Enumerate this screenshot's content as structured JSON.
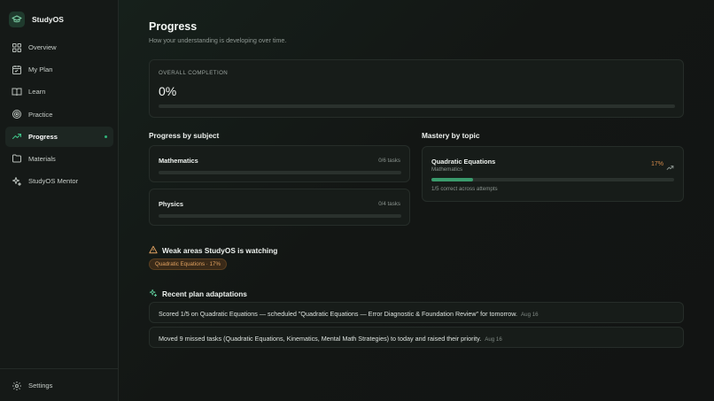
{
  "app": {
    "name": "StudyOS"
  },
  "sidebar": {
    "items": [
      {
        "label": "Overview",
        "icon": "grid-icon"
      },
      {
        "label": "My Plan",
        "icon": "calendar-icon"
      },
      {
        "label": "Learn",
        "icon": "book-icon"
      },
      {
        "label": "Practice",
        "icon": "target-icon"
      },
      {
        "label": "Progress",
        "icon": "trend-icon",
        "active": true
      },
      {
        "label": "Materials",
        "icon": "folder-icon"
      },
      {
        "label": "StudyOS Mentor",
        "icon": "sparkle-icon"
      }
    ],
    "settings_label": "Settings"
  },
  "page": {
    "title": "Progress",
    "subtitle": "How your understanding is developing over time."
  },
  "overall": {
    "label": "OVERALL COMPLETION",
    "value_text": "0%",
    "fraction": 0
  },
  "by_subject": {
    "title": "Progress by subject",
    "subjects": [
      {
        "name": "Mathematics",
        "tasks": "0/6 tasks",
        "fraction": 0
      },
      {
        "name": "Physics",
        "tasks": "0/4 tasks",
        "fraction": 0
      }
    ]
  },
  "mastery": {
    "title": "Mastery by topic",
    "topics": [
      {
        "name": "Quadratic Equations",
        "subject": "Mathematics",
        "percent_text": "17%",
        "fraction": 0.17,
        "attempts": "1/5 correct across attempts"
      }
    ]
  },
  "weak_areas": {
    "title": "Weak areas StudyOS is watching",
    "badges": [
      "Quadratic Equations · 17%"
    ]
  },
  "adaptations": {
    "title": "Recent plan adaptations",
    "items": [
      {
        "text": "Scored 1/5 on Quadratic Equations — scheduled \"Quadratic Equations — Error Diagnostic & Foundation Review\" for tomorrow.",
        "date": "Aug 16"
      },
      {
        "text": "Moved 9 missed tasks (Quadratic Equations, Kinematics, Mental Math Strategies) to today and raised their priority.",
        "date": "Aug 16"
      }
    ]
  },
  "colors": {
    "accent": "#2a8a5f",
    "warning": "#d48a4a",
    "background": "#121513"
  }
}
